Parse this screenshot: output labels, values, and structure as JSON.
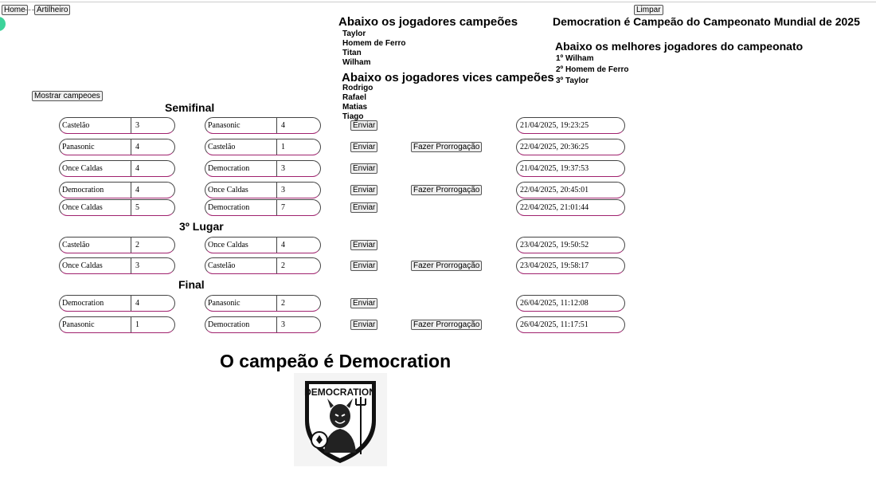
{
  "nav": {
    "home": "Home",
    "artilheiro": "Artilheiro"
  },
  "clear_button": "Limpar",
  "show_champions_button": "Mostrar campeoes",
  "champions": {
    "title": "Abaixo os jogadores campeões",
    "players": [
      "Taylor",
      "Homem de Ferro",
      "Titan",
      "Wilham"
    ]
  },
  "vices": {
    "title": "Abaixo os jogadores vices campeões",
    "players": [
      "Rodrigo",
      "Rafael",
      "Matias",
      "Tiago"
    ]
  },
  "announcement": "Democration é Campeão do Campeonato Mundial de 2025",
  "best": {
    "title": "Abaixo os melhores jogadores do campeonato",
    "players": [
      "1º Wilham",
      "2º Homem de Ferro",
      "3º Taylor"
    ]
  },
  "sections": {
    "semifinal": "Semifinal",
    "third": "3º Lugar",
    "final": "Final"
  },
  "send_label": "Enviar",
  "extra_time_label": "Fazer Prorrogação",
  "matches": [
    {
      "team1": "Castelão",
      "score1": "3",
      "team2": "Panasonic",
      "score2": "4",
      "extra": false,
      "datetime": "21/04/2025, 19:23:25"
    },
    {
      "team1": "Panasonic",
      "score1": "4",
      "team2": "Castelão",
      "score2": "1",
      "extra": true,
      "datetime": "22/04/2025, 20:36:25"
    },
    {
      "team1": "Once Caldas",
      "score1": "4",
      "team2": "Democration",
      "score2": "3",
      "extra": false,
      "datetime": "21/04/2025, 19:37:53"
    },
    {
      "team1": "Democration",
      "score1": "4",
      "team2": "Once Caldas",
      "score2": "3",
      "extra": true,
      "datetime": "22/04/2025, 20:45:01"
    },
    {
      "team1": "Once Caldas",
      "score1": "5",
      "team2": "Democration",
      "score2": "7",
      "extra": false,
      "datetime": "22/04/2025, 21:01:44"
    },
    {
      "team1": "Castelão",
      "score1": "2",
      "team2": "Once Caldas",
      "score2": "4",
      "extra": false,
      "datetime": "23/04/2025, 19:50:52"
    },
    {
      "team1": "Once Caldas",
      "score1": "3",
      "team2": "Castelão",
      "score2": "2",
      "extra": true,
      "datetime": "23/04/2025, 19:58:17"
    },
    {
      "team1": "Democration",
      "score1": "4",
      "team2": "Panasonic",
      "score2": "2",
      "extra": false,
      "datetime": "26/04/2025, 11:12:08"
    },
    {
      "team1": "Panasonic",
      "score1": "1",
      "team2": "Democration",
      "score2": "3",
      "extra": true,
      "datetime": "26/04/2025, 11:17:51"
    }
  ],
  "champion_text": "O campeão é Democration",
  "logo_text": "DEMOCRATION"
}
